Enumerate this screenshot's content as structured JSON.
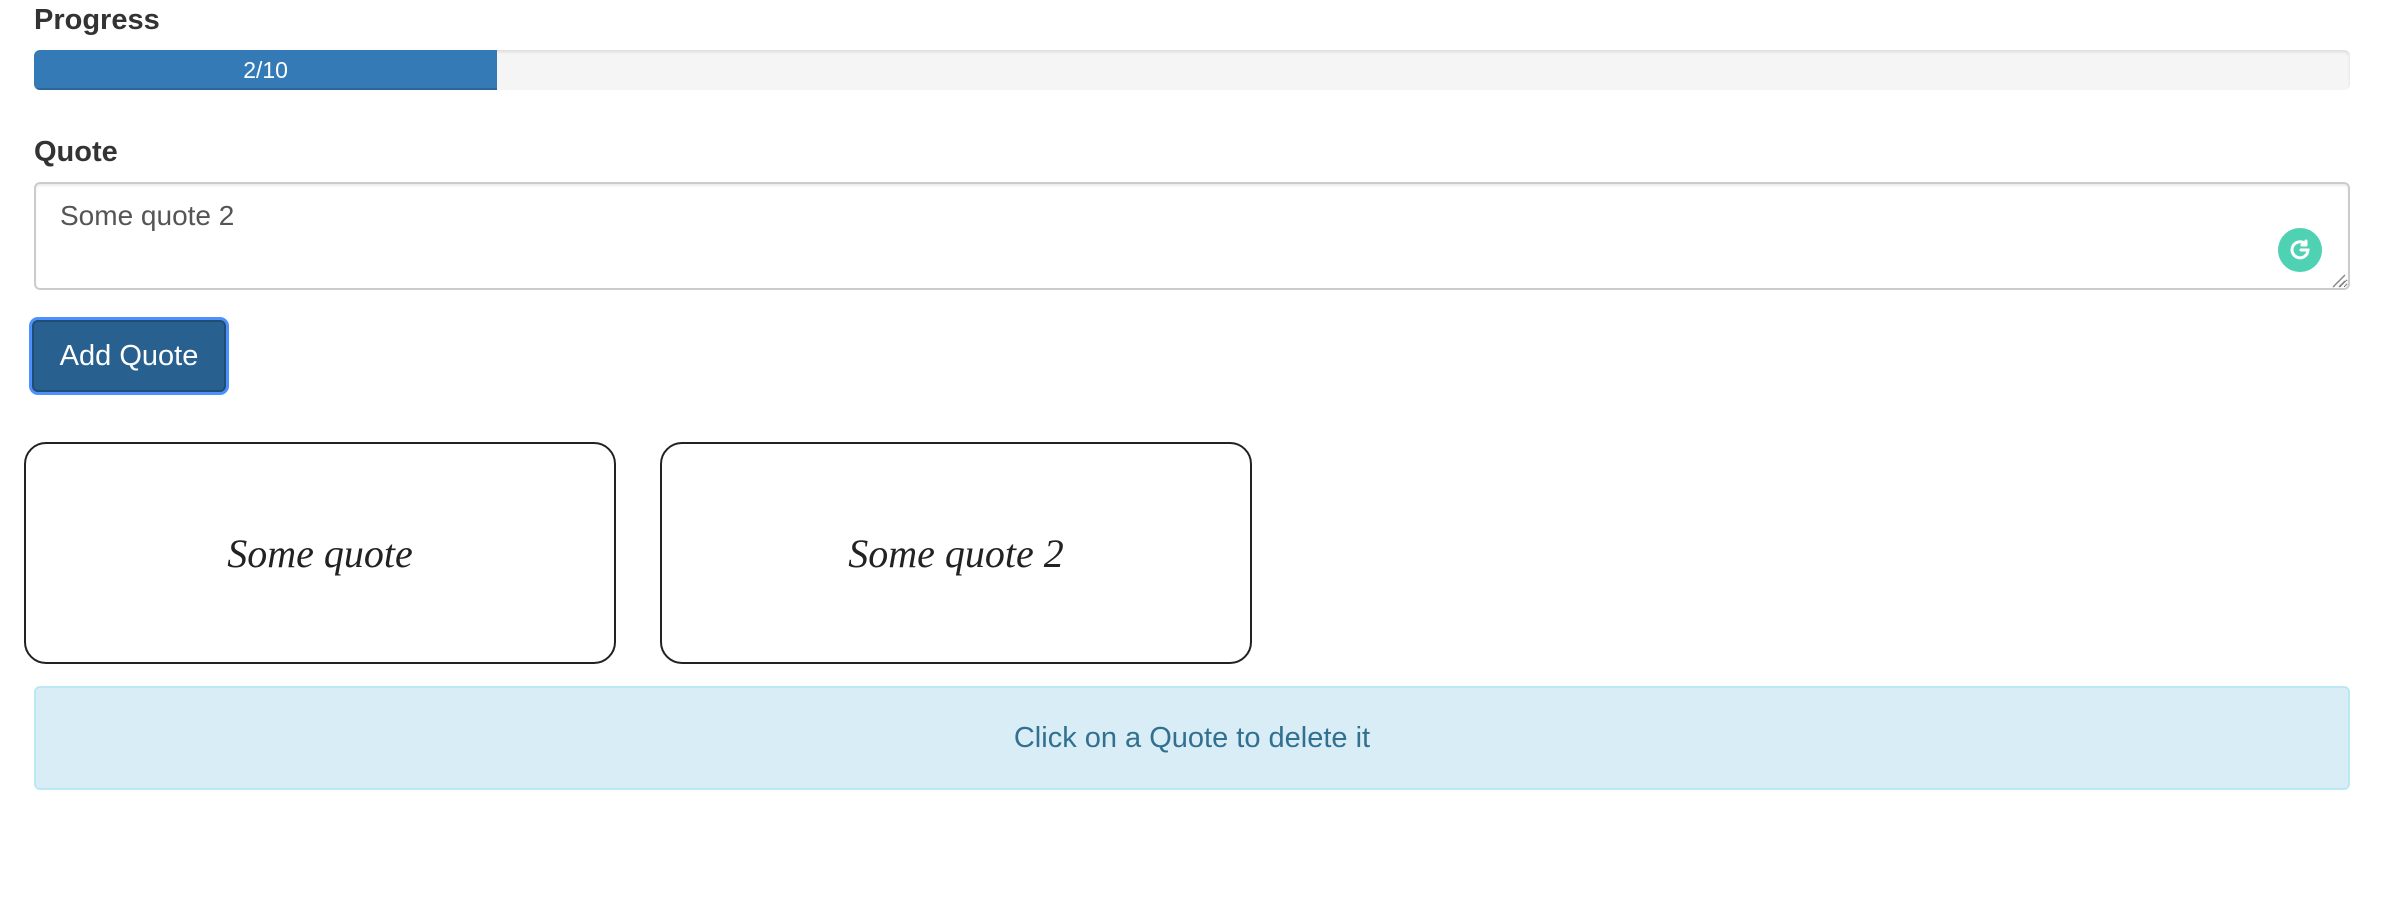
{
  "progress": {
    "label": "Progress",
    "text": "2/10",
    "value": 2,
    "max": 10,
    "fill_color": "#337ab7"
  },
  "quote_form": {
    "label": "Quote",
    "input_value": "Some quote 2",
    "grammarly_icon": "grammarly-icon",
    "add_button_label": "Add Quote"
  },
  "quotes": [
    {
      "text": "Some quote"
    },
    {
      "text": "Some quote 2"
    }
  ],
  "alert": {
    "text": "Click on a Quote to delete it",
    "background": "#d9edf7",
    "color": "#31708f"
  }
}
